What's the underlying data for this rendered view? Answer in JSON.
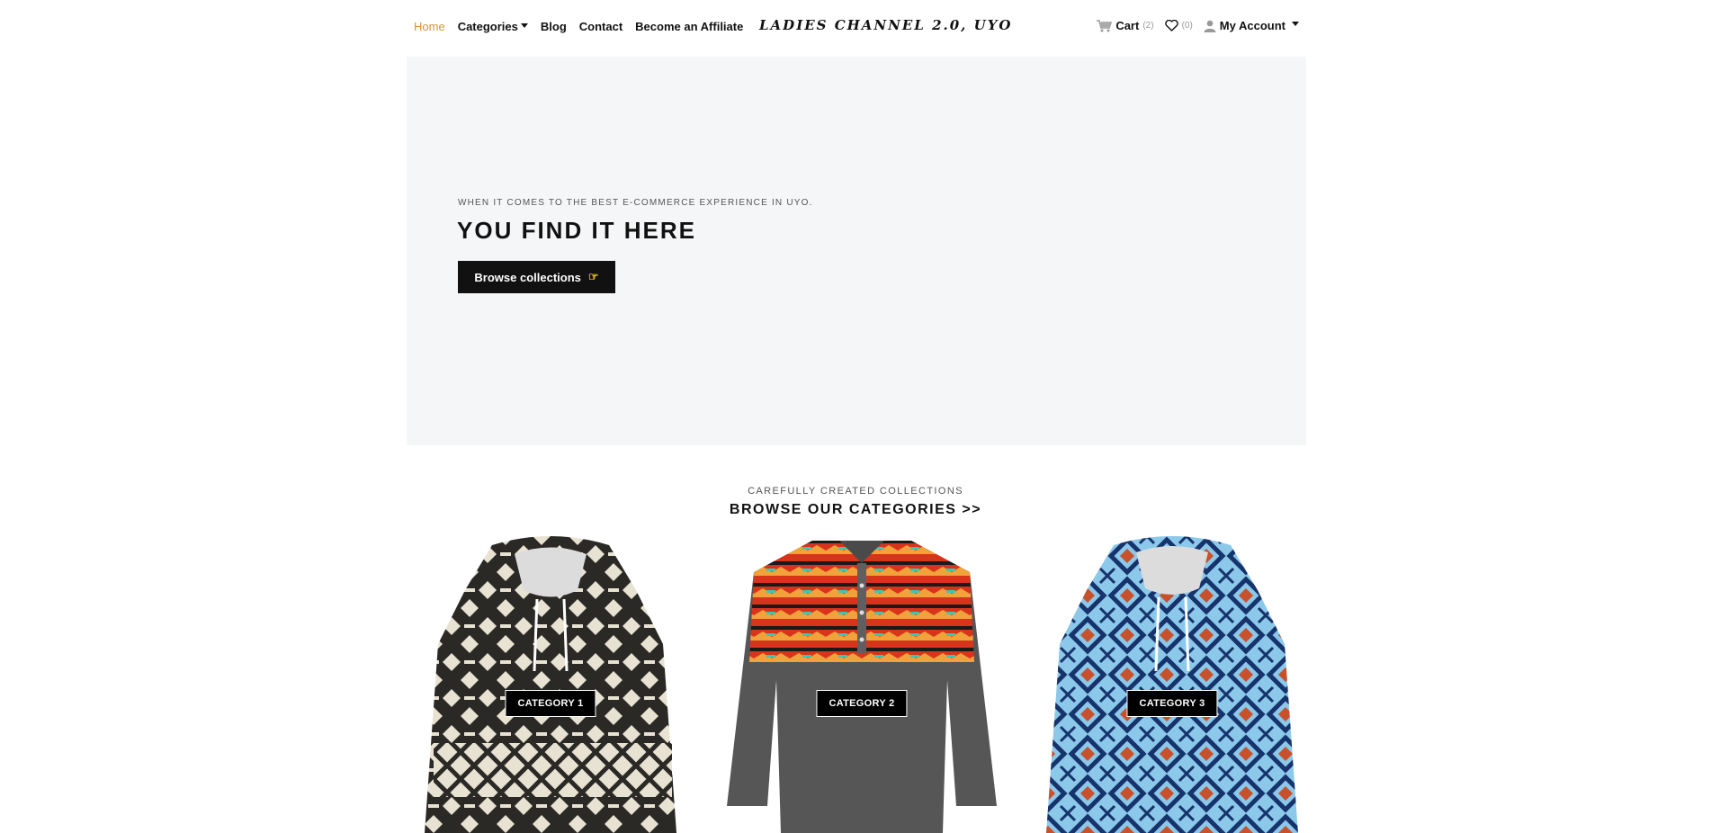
{
  "nav": {
    "links": [
      {
        "label": "Home",
        "active": true
      },
      {
        "label": "Categories",
        "dropdown": true
      },
      {
        "label": "Blog"
      },
      {
        "label": "Contact"
      },
      {
        "label": "Become an Affiliate"
      }
    ],
    "brand": "LADIES CHANNEL 2.0, UYO",
    "cart": {
      "label": "Cart",
      "count": "(2)",
      "icon": "cart-icon"
    },
    "wishlist": {
      "count": "(0)",
      "icon": "heart-icon"
    },
    "account": {
      "label": "My Account",
      "icon": "user-icon"
    },
    "accent_color": "#d4943c"
  },
  "hero": {
    "eyebrow": "WHEN IT COMES TO THE BEST E-COMMERCE EXPERIENCE IN UYO.",
    "title": "YOU FIND IT HERE",
    "button_label": "Browse collections",
    "button_icon": "pointing-hand-icon",
    "background": "#f5f6f7"
  },
  "categories_section": {
    "eyebrow": "CAREFULLY CREATED COLLECTIONS",
    "title": "BROWSE OUR CATEGORIES >>",
    "items": [
      {
        "label": "CATEGORY 1",
        "image": "black-cream-aztec-hoodie"
      },
      {
        "label": "CATEGORY 2",
        "image": "grey-henley-red-aztec-yoke"
      },
      {
        "label": "CATEGORY 3",
        "image": "blue-aztec-hoodie"
      }
    ]
  }
}
